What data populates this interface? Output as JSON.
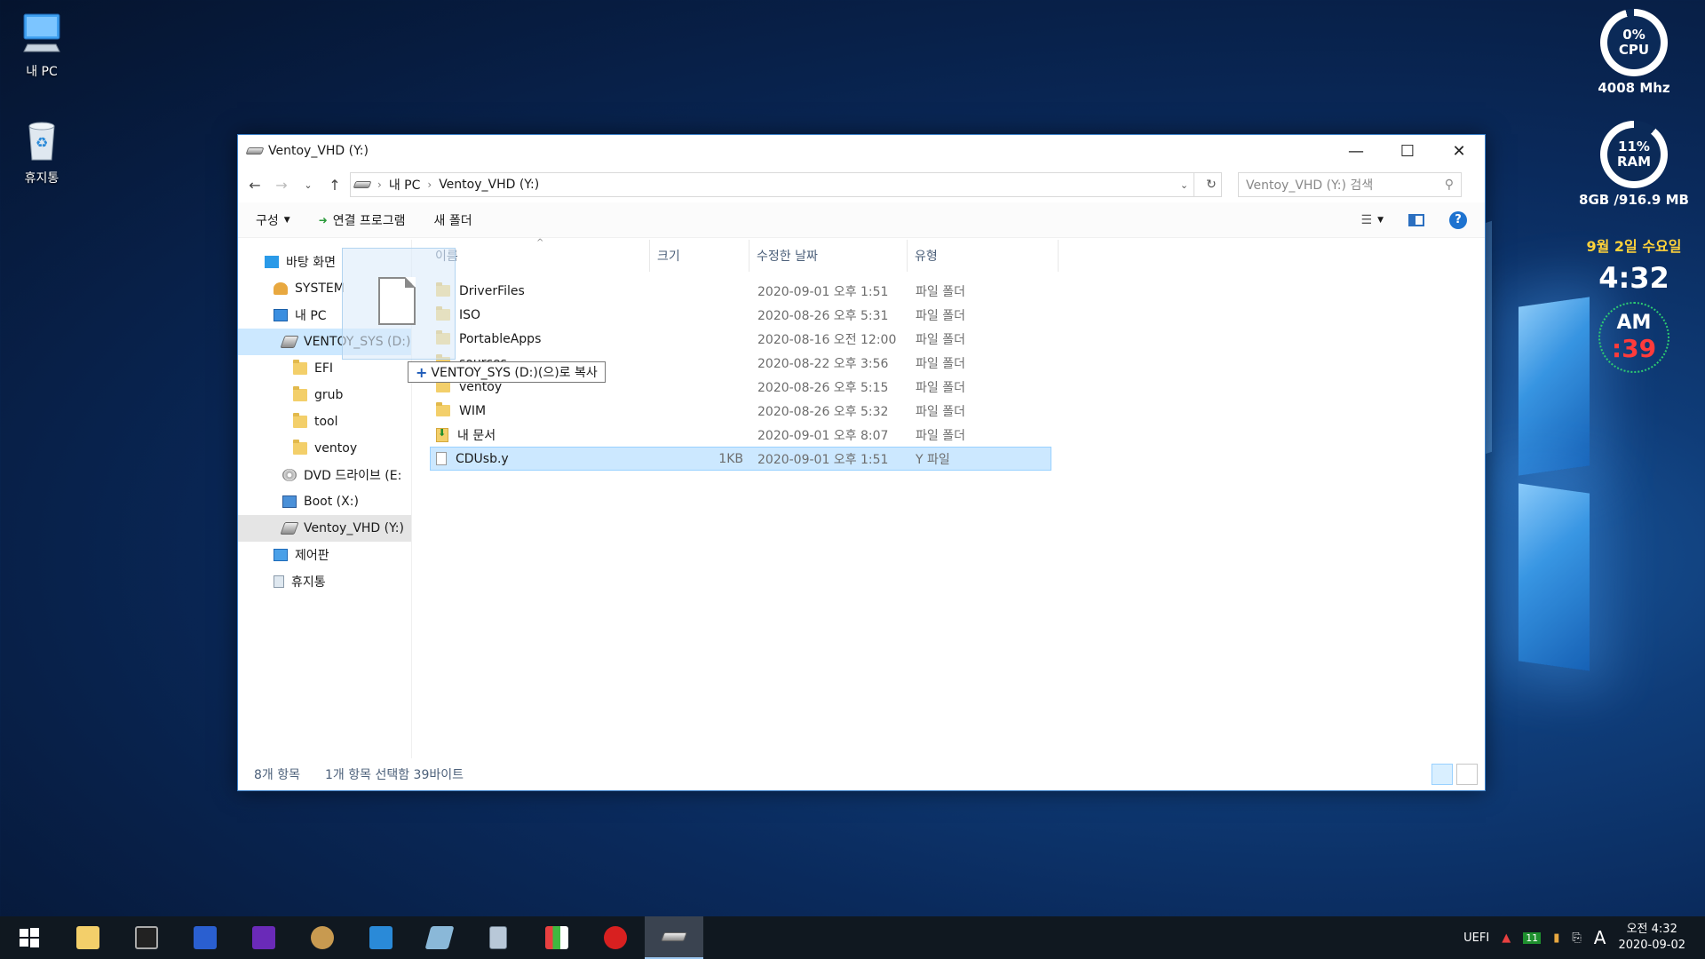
{
  "desktop": {
    "icons": [
      {
        "label": "내 PC"
      },
      {
        "label": "휴지통"
      }
    ]
  },
  "gadgets": {
    "cpu": {
      "percent": "0%",
      "label": "CPU",
      "freq": "4008 Mhz"
    },
    "ram": {
      "percent": "11%",
      "label": "RAM",
      "size": "8GB /916.9 MB"
    },
    "clock": {
      "date": "9월 2일 수요일",
      "time": "4:32",
      "ampm": "AM",
      "seconds": ":39"
    }
  },
  "window": {
    "title": "Ventoy_VHD (Y:)",
    "address": {
      "crumbs": [
        "내 PC",
        "Ventoy_VHD (Y:)"
      ]
    },
    "search_placeholder": "Ventoy_VHD (Y:) 검색",
    "commands": {
      "organize": "구성",
      "open_with": "연결 프로그램",
      "new_folder": "새 폴더"
    },
    "nav": [
      {
        "label": "바탕 화면",
        "kind": "desktop"
      },
      {
        "label": "SYSTEM",
        "kind": "user"
      },
      {
        "label": "내 PC",
        "kind": "pc"
      },
      {
        "label": "VENTOY_SYS (D:)",
        "kind": "drive"
      },
      {
        "label": "EFI",
        "kind": "folder"
      },
      {
        "label": "grub",
        "kind": "folder"
      },
      {
        "label": "tool",
        "kind": "folder"
      },
      {
        "label": "ventoy",
        "kind": "folder"
      },
      {
        "label": "DVD 드라이브 (E:",
        "kind": "dvd"
      },
      {
        "label": "Boot (X:)",
        "kind": "boot"
      },
      {
        "label": "Ventoy_VHD (Y:)",
        "kind": "drive"
      },
      {
        "label": "제어판",
        "kind": "control"
      },
      {
        "label": "휴지통",
        "kind": "recycle"
      }
    ],
    "columns": {
      "name": "이름",
      "size": "크기",
      "date": "수정한 날짜",
      "type": "유형"
    },
    "files": [
      {
        "name": "DriverFiles",
        "size": "",
        "date": "2020-09-01 오후 1:51",
        "type": "파일 폴더",
        "kind": "folder"
      },
      {
        "name": "ISO",
        "size": "",
        "date": "2020-08-26 오후 5:31",
        "type": "파일 폴더",
        "kind": "folder"
      },
      {
        "name": "PortableApps",
        "size": "",
        "date": "2020-08-16 오전 12:00",
        "type": "파일 폴더",
        "kind": "folder"
      },
      {
        "name": "sources",
        "size": "",
        "date": "2020-08-22 오후 3:56",
        "type": "파일 폴더",
        "kind": "folder"
      },
      {
        "name": "ventoy",
        "size": "",
        "date": "2020-08-26 오후 5:15",
        "type": "파일 폴더",
        "kind": "folder"
      },
      {
        "name": "WIM",
        "size": "",
        "date": "2020-08-26 오후 5:32",
        "type": "파일 폴더",
        "kind": "folder"
      },
      {
        "name": "내 문서",
        "size": "",
        "date": "2020-09-01 오후 8:07",
        "type": "파일 폴더",
        "kind": "docs"
      },
      {
        "name": "CDUsb.y",
        "size": "1KB",
        "date": "2020-09-01 오후 1:51",
        "type": "Y 파일",
        "kind": "file"
      }
    ],
    "drag": {
      "tooltip": "VENTOY_SYS (D:)(으)로 복사"
    },
    "status": {
      "count": "8개 항목",
      "selection": "1개 항목 선택함 39바이트"
    }
  },
  "taskbar": {
    "tray": {
      "uefi": "UEFI",
      "badge": "11",
      "ime": "A"
    },
    "clock": {
      "time": "오전 4:32",
      "date": "2020-09-02"
    }
  }
}
